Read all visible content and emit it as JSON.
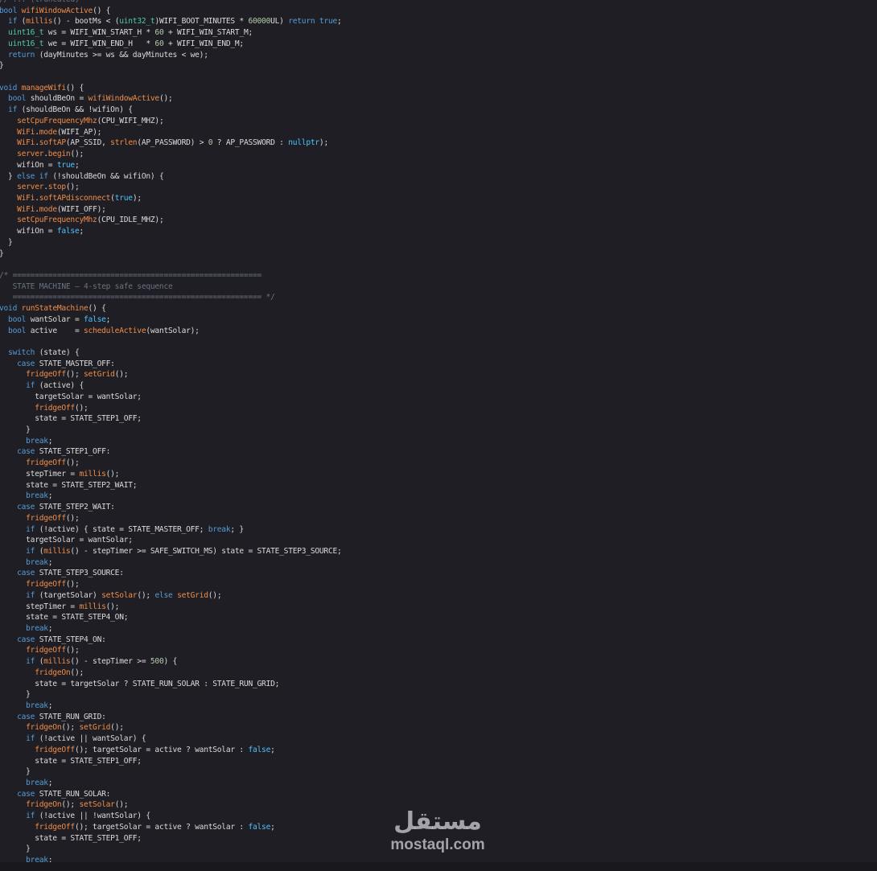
{
  "editor": {
    "colors": {
      "background": "#1e1e24",
      "keyword": "#569cd6",
      "type": "#4ec9b0",
      "function": "#f08d49",
      "number": "#b5cea8",
      "literal": "#4fc1ff",
      "comment": "#6a7380",
      "plain": "#dcdcdc"
    },
    "lines": [
      [
        {
          "t": "// ... (truncated)",
          "c": "cm"
        }
      ],
      [
        {
          "t": "bool ",
          "c": "kw"
        },
        {
          "t": "wifiWindowActive",
          "c": "fn"
        },
        {
          "t": "() {",
          "c": "pl"
        }
      ],
      [
        {
          "t": "  if ",
          "c": "kw"
        },
        {
          "t": "(",
          "c": "pl"
        },
        {
          "t": "millis",
          "c": "fn"
        },
        {
          "t": "() - bootMs < (",
          "c": "pl"
        },
        {
          "t": "uint32_t",
          "c": "ty"
        },
        {
          "t": ")WIFI_BOOT_MINUTES * ",
          "c": "pl"
        },
        {
          "t": "60000",
          "c": "num"
        },
        {
          "t": "UL) ",
          "c": "pl"
        },
        {
          "t": "return true",
          "c": "kw"
        },
        {
          "t": ";",
          "c": "pl"
        }
      ],
      [
        {
          "t": "  uint16_t ",
          "c": "ty"
        },
        {
          "t": "ws = WIFI_WIN_START_H * ",
          "c": "pl"
        },
        {
          "t": "60",
          "c": "num"
        },
        {
          "t": " + WIFI_WIN_START_M;",
          "c": "pl"
        }
      ],
      [
        {
          "t": "  uint16_t ",
          "c": "ty"
        },
        {
          "t": "we = WIFI_WIN_END_H   * ",
          "c": "pl"
        },
        {
          "t": "60",
          "c": "num"
        },
        {
          "t": " + WIFI_WIN_END_M;",
          "c": "pl"
        }
      ],
      [
        {
          "t": "  return ",
          "c": "kw"
        },
        {
          "t": "(dayMinutes >= ws && dayMinutes < we);",
          "c": "pl"
        }
      ],
      [
        {
          "t": "}",
          "c": "pl"
        }
      ],
      [],
      [
        {
          "t": "void ",
          "c": "kw"
        },
        {
          "t": "manageWifi",
          "c": "fn"
        },
        {
          "t": "() {",
          "c": "pl"
        }
      ],
      [
        {
          "t": "  bool ",
          "c": "kw"
        },
        {
          "t": "shouldBeOn = ",
          "c": "pl"
        },
        {
          "t": "wifiWindowActive",
          "c": "fn"
        },
        {
          "t": "();",
          "c": "pl"
        }
      ],
      [
        {
          "t": "  if ",
          "c": "kw"
        },
        {
          "t": "(shouldBeOn && !wifiOn) {",
          "c": "pl"
        }
      ],
      [
        {
          "t": "    setCpuFrequencyMhz",
          "c": "fn"
        },
        {
          "t": "(CPU_WIFI_MHZ);",
          "c": "pl"
        }
      ],
      [
        {
          "t": "    WiFi",
          "c": "fn"
        },
        {
          "t": ".",
          "c": "pl"
        },
        {
          "t": "mode",
          "c": "fn"
        },
        {
          "t": "(WIFI_AP);",
          "c": "pl"
        }
      ],
      [
        {
          "t": "    WiFi",
          "c": "fn"
        },
        {
          "t": ".",
          "c": "pl"
        },
        {
          "t": "softAP",
          "c": "fn"
        },
        {
          "t": "(AP_SSID, ",
          "c": "pl"
        },
        {
          "t": "strlen",
          "c": "fn"
        },
        {
          "t": "(AP_PASSWORD) > ",
          "c": "pl"
        },
        {
          "t": "0",
          "c": "num"
        },
        {
          "t": " ? AP_PASSWORD : ",
          "c": "pl"
        },
        {
          "t": "nullptr",
          "c": "lit"
        },
        {
          "t": ");",
          "c": "pl"
        }
      ],
      [
        {
          "t": "    server",
          "c": "fn"
        },
        {
          "t": ".",
          "c": "pl"
        },
        {
          "t": "begin",
          "c": "fn"
        },
        {
          "t": "();",
          "c": "pl"
        }
      ],
      [
        {
          "t": "    wifiOn = ",
          "c": "pl"
        },
        {
          "t": "true",
          "c": "lit"
        },
        {
          "t": ";",
          "c": "pl"
        }
      ],
      [
        {
          "t": "  } ",
          "c": "pl"
        },
        {
          "t": "else if ",
          "c": "kw"
        },
        {
          "t": "(!shouldBeOn && wifiOn) {",
          "c": "pl"
        }
      ],
      [
        {
          "t": "    server",
          "c": "fn"
        },
        {
          "t": ".",
          "c": "pl"
        },
        {
          "t": "stop",
          "c": "fn"
        },
        {
          "t": "();",
          "c": "pl"
        }
      ],
      [
        {
          "t": "    WiFi",
          "c": "fn"
        },
        {
          "t": ".",
          "c": "pl"
        },
        {
          "t": "softAPdisconnect",
          "c": "fn"
        },
        {
          "t": "(",
          "c": "pl"
        },
        {
          "t": "true",
          "c": "lit"
        },
        {
          "t": ");",
          "c": "pl"
        }
      ],
      [
        {
          "t": "    WiFi",
          "c": "fn"
        },
        {
          "t": ".",
          "c": "pl"
        },
        {
          "t": "mode",
          "c": "fn"
        },
        {
          "t": "(WIFI_OFF);",
          "c": "pl"
        }
      ],
      [
        {
          "t": "    setCpuFrequencyMhz",
          "c": "fn"
        },
        {
          "t": "(CPU_IDLE_MHZ);",
          "c": "pl"
        }
      ],
      [
        {
          "t": "    wifiOn = ",
          "c": "pl"
        },
        {
          "t": "false",
          "c": "lit"
        },
        {
          "t": ";",
          "c": "pl"
        }
      ],
      [
        {
          "t": "  }",
          "c": "pl"
        }
      ],
      [
        {
          "t": "}",
          "c": "pl"
        }
      ],
      [],
      [
        {
          "t": "/* ========================================================",
          "c": "cm"
        }
      ],
      [
        {
          "t": "   STATE MACHINE — 4-step safe sequence",
          "c": "cm"
        }
      ],
      [
        {
          "t": "   ======================================================== */",
          "c": "cm"
        }
      ],
      [
        {
          "t": "void ",
          "c": "kw"
        },
        {
          "t": "runStateMachine",
          "c": "fn"
        },
        {
          "t": "() {",
          "c": "pl"
        }
      ],
      [
        {
          "t": "  bool ",
          "c": "kw"
        },
        {
          "t": "wantSolar = ",
          "c": "pl"
        },
        {
          "t": "false",
          "c": "lit"
        },
        {
          "t": ";",
          "c": "pl"
        }
      ],
      [
        {
          "t": "  bool ",
          "c": "kw"
        },
        {
          "t": "active    = ",
          "c": "pl"
        },
        {
          "t": "scheduleActive",
          "c": "fn"
        },
        {
          "t": "(wantSolar);",
          "c": "pl"
        }
      ],
      [],
      [
        {
          "t": "  switch ",
          "c": "kw"
        },
        {
          "t": "(state) {",
          "c": "pl"
        }
      ],
      [
        {
          "t": "    case ",
          "c": "kw"
        },
        {
          "t": "STATE_MASTER_OFF:",
          "c": "pl"
        }
      ],
      [
        {
          "t": "      fridgeOff",
          "c": "fn"
        },
        {
          "t": "(); ",
          "c": "pl"
        },
        {
          "t": "setGrid",
          "c": "fn"
        },
        {
          "t": "();",
          "c": "pl"
        }
      ],
      [
        {
          "t": "      if ",
          "c": "kw"
        },
        {
          "t": "(active) {",
          "c": "pl"
        }
      ],
      [
        {
          "t": "        targetSolar = wantSolar;",
          "c": "pl"
        }
      ],
      [
        {
          "t": "        fridgeOff",
          "c": "fn"
        },
        {
          "t": "();",
          "c": "pl"
        }
      ],
      [
        {
          "t": "        state = STATE_STEP1_OFF;",
          "c": "pl"
        }
      ],
      [
        {
          "t": "      }",
          "c": "pl"
        }
      ],
      [
        {
          "t": "      break",
          "c": "kw"
        },
        {
          "t": ";",
          "c": "pl"
        }
      ],
      [
        {
          "t": "    case ",
          "c": "kw"
        },
        {
          "t": "STATE_STEP1_OFF:",
          "c": "pl"
        }
      ],
      [
        {
          "t": "      fridgeOff",
          "c": "fn"
        },
        {
          "t": "();",
          "c": "pl"
        }
      ],
      [
        {
          "t": "      stepTimer = ",
          "c": "pl"
        },
        {
          "t": "millis",
          "c": "fn"
        },
        {
          "t": "();",
          "c": "pl"
        }
      ],
      [
        {
          "t": "      state = STATE_STEP2_WAIT;",
          "c": "pl"
        }
      ],
      [
        {
          "t": "      break",
          "c": "kw"
        },
        {
          "t": ";",
          "c": "pl"
        }
      ],
      [
        {
          "t": "    case ",
          "c": "kw"
        },
        {
          "t": "STATE_STEP2_WAIT:",
          "c": "pl"
        }
      ],
      [
        {
          "t": "      fridgeOff",
          "c": "fn"
        },
        {
          "t": "();",
          "c": "pl"
        }
      ],
      [
        {
          "t": "      if ",
          "c": "kw"
        },
        {
          "t": "(!active) { state = STATE_MASTER_OFF; ",
          "c": "pl"
        },
        {
          "t": "break",
          "c": "kw"
        },
        {
          "t": "; }",
          "c": "pl"
        }
      ],
      [
        {
          "t": "      targetSolar = wantSolar;",
          "c": "pl"
        }
      ],
      [
        {
          "t": "      if ",
          "c": "kw"
        },
        {
          "t": "(",
          "c": "pl"
        },
        {
          "t": "millis",
          "c": "fn"
        },
        {
          "t": "() - stepTimer >= SAFE_SWITCH_MS) state = STATE_STEP3_SOURCE;",
          "c": "pl"
        }
      ],
      [
        {
          "t": "      break",
          "c": "kw"
        },
        {
          "t": ";",
          "c": "pl"
        }
      ],
      [
        {
          "t": "    case ",
          "c": "kw"
        },
        {
          "t": "STATE_STEP3_SOURCE:",
          "c": "pl"
        }
      ],
      [
        {
          "t": "      fridgeOff",
          "c": "fn"
        },
        {
          "t": "();",
          "c": "pl"
        }
      ],
      [
        {
          "t": "      if ",
          "c": "kw"
        },
        {
          "t": "(targetSolar) ",
          "c": "pl"
        },
        {
          "t": "setSolar",
          "c": "fn"
        },
        {
          "t": "(); ",
          "c": "pl"
        },
        {
          "t": "else ",
          "c": "kw"
        },
        {
          "t": "setGrid",
          "c": "fn"
        },
        {
          "t": "();",
          "c": "pl"
        }
      ],
      [
        {
          "t": "      stepTimer = ",
          "c": "pl"
        },
        {
          "t": "millis",
          "c": "fn"
        },
        {
          "t": "();",
          "c": "pl"
        }
      ],
      [
        {
          "t": "      state = STATE_STEP4_ON;",
          "c": "pl"
        }
      ],
      [
        {
          "t": "      break",
          "c": "kw"
        },
        {
          "t": ";",
          "c": "pl"
        }
      ],
      [
        {
          "t": "    case ",
          "c": "kw"
        },
        {
          "t": "STATE_STEP4_ON:",
          "c": "pl"
        }
      ],
      [
        {
          "t": "      fridgeOff",
          "c": "fn"
        },
        {
          "t": "();",
          "c": "pl"
        }
      ],
      [
        {
          "t": "      if ",
          "c": "kw"
        },
        {
          "t": "(",
          "c": "pl"
        },
        {
          "t": "millis",
          "c": "fn"
        },
        {
          "t": "() - stepTimer >= ",
          "c": "pl"
        },
        {
          "t": "500",
          "c": "num"
        },
        {
          "t": ") {",
          "c": "pl"
        }
      ],
      [
        {
          "t": "        fridgeOn",
          "c": "fn"
        },
        {
          "t": "();",
          "c": "pl"
        }
      ],
      [
        {
          "t": "        state = targetSolar ? STATE_RUN_SOLAR : STATE_RUN_GRID;",
          "c": "pl"
        }
      ],
      [
        {
          "t": "      }",
          "c": "pl"
        }
      ],
      [
        {
          "t": "      break",
          "c": "kw"
        },
        {
          "t": ";",
          "c": "pl"
        }
      ],
      [
        {
          "t": "    case ",
          "c": "kw"
        },
        {
          "t": "STATE_RUN_GRID:",
          "c": "pl"
        }
      ],
      [
        {
          "t": "      fridgeOn",
          "c": "fn"
        },
        {
          "t": "(); ",
          "c": "pl"
        },
        {
          "t": "setGrid",
          "c": "fn"
        },
        {
          "t": "();",
          "c": "pl"
        }
      ],
      [
        {
          "t": "      if ",
          "c": "kw"
        },
        {
          "t": "(!active || wantSolar) {",
          "c": "pl"
        }
      ],
      [
        {
          "t": "        fridgeOff",
          "c": "fn"
        },
        {
          "t": "(); targetSolar = active ? wantSolar : ",
          "c": "pl"
        },
        {
          "t": "false",
          "c": "lit"
        },
        {
          "t": ";",
          "c": "pl"
        }
      ],
      [
        {
          "t": "        state = STATE_STEP1_OFF;",
          "c": "pl"
        }
      ],
      [
        {
          "t": "      }",
          "c": "pl"
        }
      ],
      [
        {
          "t": "      break",
          "c": "kw"
        },
        {
          "t": ";",
          "c": "pl"
        }
      ],
      [
        {
          "t": "    case ",
          "c": "kw"
        },
        {
          "t": "STATE_RUN_SOLAR:",
          "c": "pl"
        }
      ],
      [
        {
          "t": "      fridgeOn",
          "c": "fn"
        },
        {
          "t": "(); ",
          "c": "pl"
        },
        {
          "t": "setSolar",
          "c": "fn"
        },
        {
          "t": "();",
          "c": "pl"
        }
      ],
      [
        {
          "t": "      if ",
          "c": "kw"
        },
        {
          "t": "(!active || !wantSolar) {",
          "c": "pl"
        }
      ],
      [
        {
          "t": "        fridgeOff",
          "c": "fn"
        },
        {
          "t": "(); targetSolar = active ? wantSolar : ",
          "c": "pl"
        },
        {
          "t": "false",
          "c": "lit"
        },
        {
          "t": ";",
          "c": "pl"
        }
      ],
      [
        {
          "t": "        state = STATE_STEP1_OFF;",
          "c": "pl"
        }
      ],
      [
        {
          "t": "      }",
          "c": "pl"
        }
      ],
      [
        {
          "t": "      break",
          "c": "kw"
        },
        {
          "t": ";",
          "c": "pl"
        }
      ]
    ]
  },
  "watermark": {
    "arabic": "مستقل",
    "latin": "mostaql.com"
  }
}
